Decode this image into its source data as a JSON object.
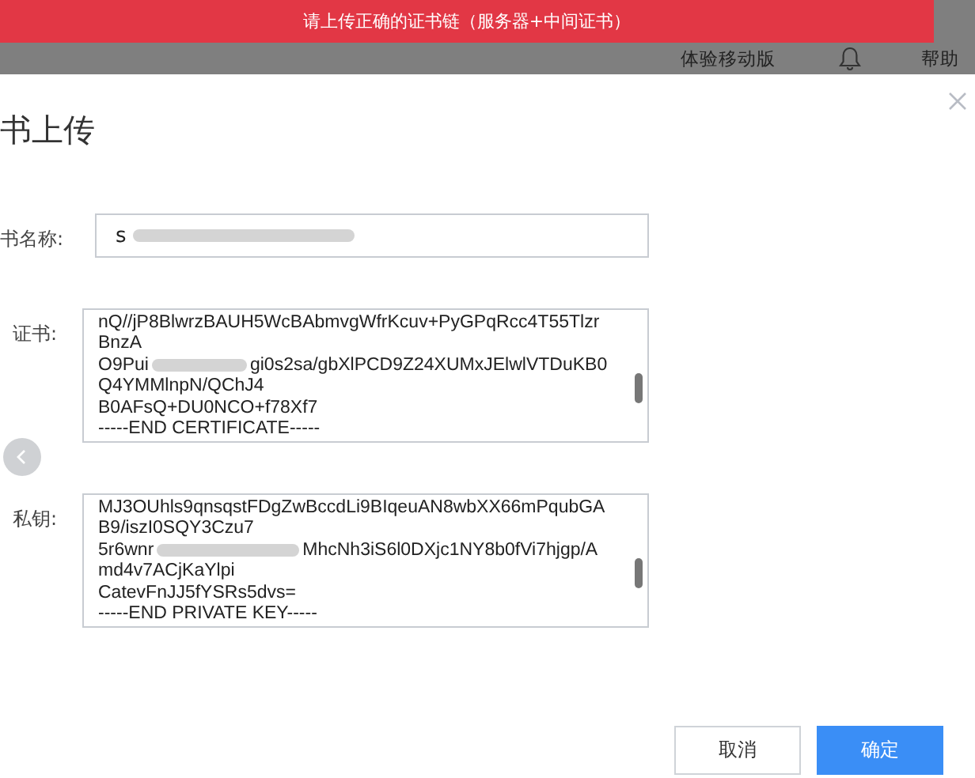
{
  "alert_banner": {
    "message": "请上传正确的证书链（服务器+中间证书）"
  },
  "header": {
    "items": [
      {
        "kind": "text",
        "label": "体验移动版"
      },
      {
        "kind": "bell"
      },
      {
        "kind": "text",
        "label": "帮助"
      }
    ]
  },
  "dialog": {
    "title": "书上传",
    "fields": [
      {
        "kind": "input",
        "label": "书名称:",
        "value": "s"
      },
      {
        "kind": "textarea",
        "label": "证书:",
        "lines": [
          [
            "nQ//jP8BlwrzBAUH5WcBAbmvgWfrKcuv+PyGPqRcc4T55Tlzr"
          ],
          [
            "BnzA"
          ],
          [
            "O9Pui",
            "gi0s2sa/gbXlPCD9Z24XUMxJElwlVTDuKB0"
          ],
          [
            "Q4YMMlnpN/QChJ4"
          ],
          [
            "B0AFsQ+DU0NCO+f78Xf7"
          ],
          [
            "-----END CERTIFICATE-----"
          ]
        ]
      },
      {
        "kind": "textarea",
        "label": "私钥:",
        "lines": [
          [
            "MJ3OUhls9qnsqstFDgZwBccdLi9BIqeuAN8wbXX66mPqubGA"
          ],
          [
            "B9/iszI0SQY3Czu7"
          ],
          [
            "5r6wnr",
            "MhcNh3iS6l0DXjc1NY8b0fVi7hjgp/A"
          ],
          [
            "md4v7ACjKaYlpi"
          ],
          [
            "CatevFnJJ5fYSRs5dvs="
          ],
          [
            "-----END PRIVATE KEY-----"
          ]
        ]
      }
    ],
    "buttons": [
      {
        "label": "取消",
        "primary": false
      },
      {
        "label": "确定",
        "primary": true
      }
    ]
  }
}
